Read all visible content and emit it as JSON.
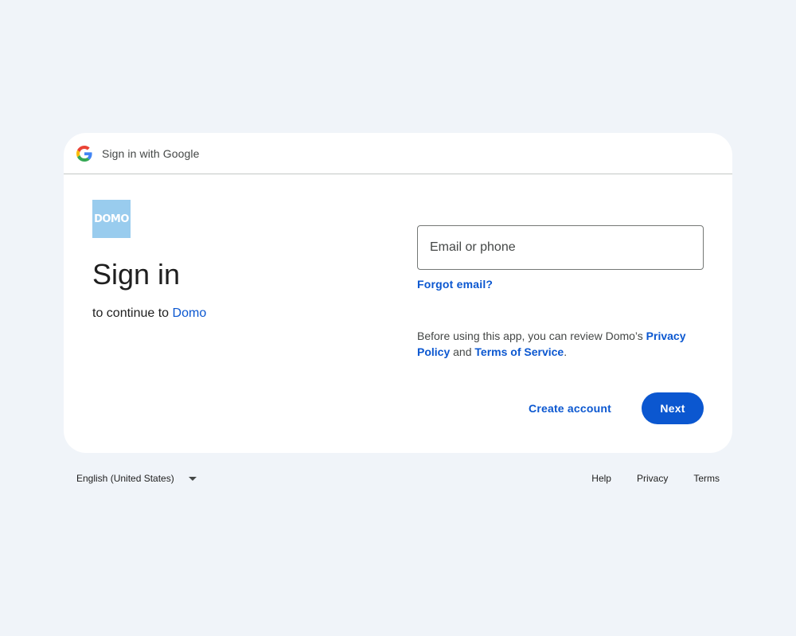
{
  "header": {
    "title": "Sign in with Google",
    "icon": "google-g-icon"
  },
  "app": {
    "logo_text": "DOMO",
    "logo_color": "#99ccee"
  },
  "main": {
    "title": "Sign in",
    "subtitle_prefix": "to continue to",
    "app_name": "Domo"
  },
  "form": {
    "email_placeholder": "Email or phone",
    "email_value": "",
    "forgot_label": "Forgot email?"
  },
  "policy": {
    "prefix": "Before using this app, you can review Domo’s",
    "privacy_label": "Privacy Policy",
    "and_text": "and",
    "terms_label": "Terms of Service",
    "suffix": "."
  },
  "actions": {
    "create_account_label": "Create account",
    "next_label": "Next"
  },
  "footer": {
    "language": "English (United States)",
    "links": {
      "help": "Help",
      "privacy": "Privacy",
      "terms": "Terms"
    }
  },
  "colors": {
    "background": "#f0f4f9",
    "accent": "#0b57d0",
    "card": "#ffffff"
  }
}
